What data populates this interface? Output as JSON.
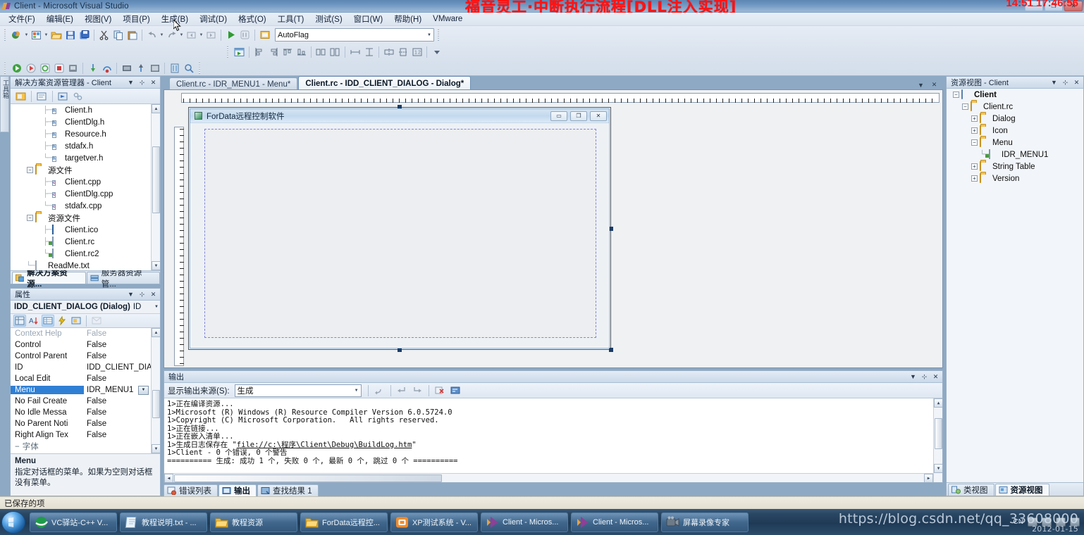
{
  "window": {
    "title": "Client - Microsoft Visual Studio",
    "logo_icon": "visual-studio-logo-icon",
    "minimize_label": "—",
    "maximize_label": "❐",
    "close_label": "✕",
    "overlay_text": "福音灵工·中断执行流程[DLL注入实现]",
    "overlay_time": "14:51 17:46:56"
  },
  "menubar": {
    "items": [
      {
        "label": "文件(F)",
        "name": "menu-file"
      },
      {
        "label": "编辑(E)",
        "name": "menu-edit"
      },
      {
        "label": "视图(V)",
        "name": "menu-view"
      },
      {
        "label": "项目(P)",
        "name": "menu-project"
      },
      {
        "label": "生成(B)",
        "name": "menu-build"
      },
      {
        "label": "调试(D)",
        "name": "menu-debug"
      },
      {
        "label": "格式(O)",
        "name": "menu-format"
      },
      {
        "label": "工具(T)",
        "name": "menu-tools"
      },
      {
        "label": "测试(S)",
        "name": "menu-test"
      },
      {
        "label": "窗口(W)",
        "name": "menu-window"
      },
      {
        "label": "帮助(H)",
        "name": "menu-help"
      },
      {
        "label": "VMware",
        "name": "menu-vmware"
      }
    ]
  },
  "toolbar": {
    "config_combo_value": "AutoFlag",
    "config_combo_arrow": "▼"
  },
  "solution_explorer": {
    "title": "解决方案资源管理器 - Client",
    "title_main": "解决方案资源管理器",
    "title_sub": " - Client",
    "dropdown_icon": "▼",
    "pin_icon": "⊹",
    "close_icon": "✕",
    "nodes": [
      {
        "label": "Client.h",
        "icon": "header-file-icon",
        "indent": 3,
        "glyph": "h"
      },
      {
        "label": "ClientDlg.h",
        "icon": "header-file-icon",
        "indent": 3,
        "glyph": "h"
      },
      {
        "label": "Resource.h",
        "icon": "header-file-icon",
        "indent": 3,
        "glyph": "h"
      },
      {
        "label": "stdafx.h",
        "icon": "header-file-icon",
        "indent": 3,
        "glyph": "h"
      },
      {
        "label": "targetver.h",
        "icon": "header-file-icon",
        "indent": 3,
        "glyph": "h",
        "last": true
      },
      {
        "label": "源文件",
        "icon": "folder-icon",
        "indent": 1,
        "expander": "−"
      },
      {
        "label": "Client.cpp",
        "icon": "cpp-file-icon",
        "indent": 3,
        "glyph": "c"
      },
      {
        "label": "ClientDlg.cpp",
        "icon": "cpp-file-icon",
        "indent": 3,
        "glyph": "c"
      },
      {
        "label": "stdafx.cpp",
        "icon": "cpp-file-icon",
        "indent": 3,
        "glyph": "c",
        "last": true
      },
      {
        "label": "资源文件",
        "icon": "folder-icon",
        "indent": 1,
        "expander": "−"
      },
      {
        "label": "Client.ico",
        "icon": "icon-file-icon",
        "indent": 3
      },
      {
        "label": "Client.rc",
        "icon": "resource-file-icon",
        "indent": 3
      },
      {
        "label": "Client.rc2",
        "icon": "resource-file-icon",
        "indent": 3,
        "last": true
      },
      {
        "label": "ReadMe.txt",
        "icon": "text-file-icon",
        "indent": 1,
        "last": true
      }
    ],
    "tabs": [
      {
        "label": "解决方案资源...",
        "icon": "solution-explorer-icon",
        "active": true
      },
      {
        "label": "服务器资源管...",
        "icon": "server-explorer-icon",
        "active": false
      }
    ]
  },
  "vertical_tab": {
    "label": "工具箱"
  },
  "properties": {
    "title": "属性",
    "dropdown_icon": "▼",
    "pin_icon": "⊹",
    "close_icon": "✕",
    "object_name": "IDD_CLIENT_DIALOG (Dialog)",
    "object_suffix": "ID",
    "object_arrow": "▼",
    "toolbar_buttons": [
      {
        "name": "categorized-button",
        "label": "⊞",
        "active": true
      },
      {
        "name": "alphabetical-button",
        "label": "A↓",
        "active": false
      },
      {
        "name": "properties-button",
        "label": "▤",
        "active": true
      },
      {
        "name": "events-button",
        "label": "⚡",
        "active": false
      },
      {
        "name": "property-pages-button",
        "label": "▣",
        "active": false
      },
      {
        "name": "messages-button",
        "label": "▥",
        "active": false,
        "disabled": true
      }
    ],
    "rows": [
      {
        "name": "Context Help",
        "value": "False",
        "dim": true
      },
      {
        "name": "Control",
        "value": "False"
      },
      {
        "name": "Control Parent",
        "value": "False"
      },
      {
        "name": "ID",
        "value": "IDD_CLIENT_DIA"
      },
      {
        "name": "Local Edit",
        "value": "False"
      },
      {
        "name": "Menu",
        "value": "IDR_MENU1",
        "selected": true,
        "dropdown": true
      },
      {
        "name": "No Fail Create",
        "value": "False"
      },
      {
        "name": "No Idle Messa",
        "value": "False"
      },
      {
        "name": "No Parent Noti",
        "value": "False"
      },
      {
        "name": "Right Align Tex",
        "value": "False"
      },
      {
        "name": "字体",
        "value": "",
        "category": true,
        "expander": "−"
      }
    ],
    "description_title": "Menu",
    "description_body": "指定对话框的菜单。如果为空则对话框没有菜单。"
  },
  "document_tabs": [
    {
      "label": "Client.rc - IDR_MENU1 - Menu*",
      "active": false,
      "name": "tab-menu-editor"
    },
    {
      "label": "Client.rc - IDD_CLIENT_DIALOG - Dialog*",
      "active": true,
      "name": "tab-dialog-editor"
    }
  ],
  "dialog_preview": {
    "icon": "app-icon",
    "title": "ForData远程控制软件",
    "minimize_label": "▭",
    "maximize_label": "❐",
    "close_label": "✕"
  },
  "output": {
    "title": "输出",
    "dropdown_icon": "▼",
    "pin_icon": "⊹",
    "close_icon": "✕",
    "source_label": "显示输出来源(S):",
    "source_value": "生成",
    "source_arrow": "▼",
    "toolbar_icons": [
      "find-message-icon",
      "goto-previous-icon",
      "goto-next-icon",
      "clear-all-icon",
      "word-wrap-icon"
    ],
    "lines": [
      "1>正在编译资源...",
      "1>Microsoft (R) Windows (R) Resource Compiler Version 6.0.5724.0",
      "1>Copyright (C) Microsoft Corporation.   All rights reserved.",
      "1>正在链接...",
      "1>正在嵌入清单...",
      "1>生成日志保存在 \"file://c:\\程序\\Client\\Debug\\BuildLog.htm\"",
      "1>Client - 0 个错误, 0 个警告",
      "========== 生成: 成功 1 个, 失败 0 个, 最新 0 个, 跳过 0 个 =========="
    ],
    "link_line_index": 5,
    "link_text": "file://c:\\程序\\Client\\Debug\\BuildLog.htm"
  },
  "bottom_tabs": [
    {
      "label": "错误列表",
      "icon": "error-list-icon",
      "active": false
    },
    {
      "label": "输出",
      "icon": "output-icon",
      "active": true
    },
    {
      "label": "查找结果 1",
      "icon": "find-results-icon",
      "active": false
    }
  ],
  "resource_view": {
    "title": "资源视图 - Client",
    "title_main": "资源视图",
    "title_sub": " - Client",
    "dropdown_icon": "▼",
    "pin_icon": "⊹",
    "close_icon": "✕",
    "nodes": [
      {
        "label": "Client",
        "icon": "project-icon",
        "indent": 0,
        "expander": "−",
        "bold": true
      },
      {
        "label": "Client.rc",
        "icon": "folder-icon",
        "indent": 1,
        "expander": "−"
      },
      {
        "label": "Dialog",
        "icon": "folder-icon",
        "indent": 2,
        "expander": "+"
      },
      {
        "label": "Icon",
        "icon": "folder-icon",
        "indent": 2,
        "expander": "+"
      },
      {
        "label": "Menu",
        "icon": "folder-icon",
        "indent": 2,
        "expander": "−"
      },
      {
        "label": "IDR_MENU1",
        "icon": "menu-resource-icon",
        "indent": 3
      },
      {
        "label": "String Table",
        "icon": "folder-icon",
        "indent": 2,
        "expander": "+"
      },
      {
        "label": "Version",
        "icon": "folder-icon",
        "indent": 2,
        "expander": "+"
      }
    ],
    "tabs": [
      {
        "label": "类视图",
        "icon": "class-view-icon",
        "active": false
      },
      {
        "label": "资源视图",
        "icon": "resource-view-icon",
        "active": true
      }
    ]
  },
  "statusbar": {
    "text": "已保存的项"
  },
  "taskbar": {
    "start_label": "start-orb",
    "items": [
      {
        "label": "VC驿站-C++ V...",
        "icon": "ie-browser-icon"
      },
      {
        "label": "教程说明.txt - ...",
        "icon": "notepad-icon"
      },
      {
        "label": "教程资源",
        "icon": "folder-icon"
      },
      {
        "label": "ForData远程控...",
        "icon": "folder-icon"
      },
      {
        "label": "XP测试系统 - V...",
        "icon": "vmware-icon"
      },
      {
        "label": "Client - Micros...",
        "icon": "visual-studio-icon"
      },
      {
        "label": "Client - Micros...",
        "icon": "visual-studio-icon"
      },
      {
        "label": "屏幕录像专家",
        "icon": "screen-recorder-icon"
      }
    ],
    "tray": {
      "ime": "CN",
      "icons": [
        "keyboard-icon",
        "action-center-icon",
        "network-icon",
        "volume-icon"
      ]
    },
    "watermark": "https://blog.csdn.net/qq_33608000",
    "watermark_date": "2012-01-15"
  }
}
